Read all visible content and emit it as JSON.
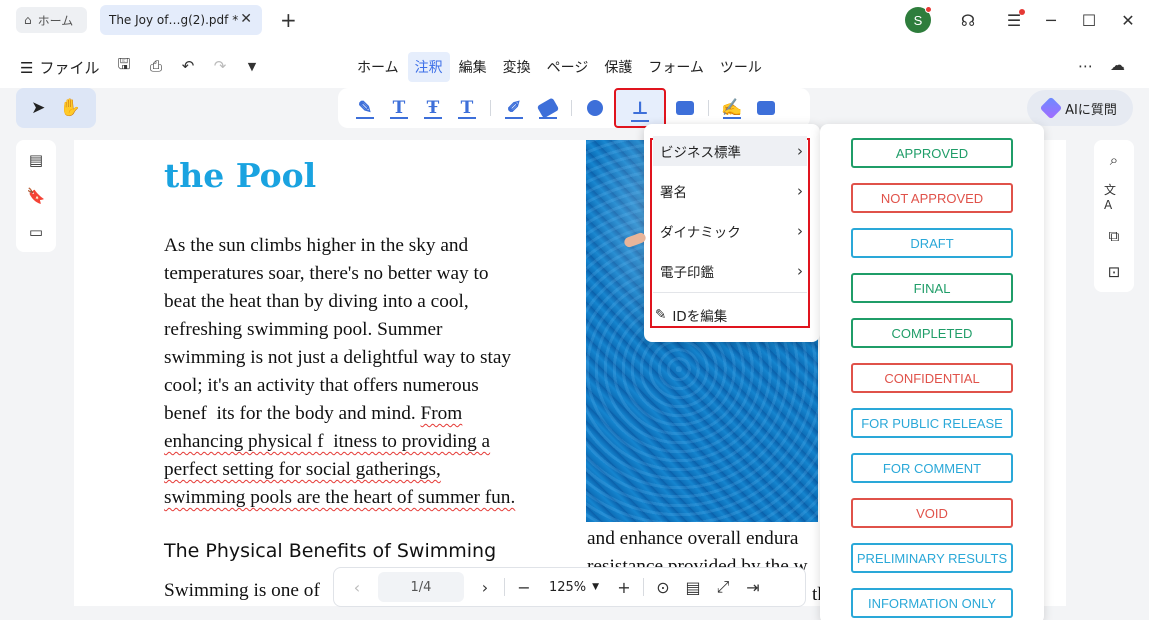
{
  "titlebar": {
    "home_label": "ホーム",
    "doc_tab_label": "The Joy of…g(2).pdf *",
    "avatar_letter": "S"
  },
  "menu": {
    "file_label": "ファイル",
    "tabs": [
      "ホーム",
      "注釈",
      "編集",
      "変換",
      "ページ",
      "保護",
      "フォーム",
      "ツール"
    ],
    "active_tab": "注釈"
  },
  "toolbar": {
    "ai_label": "AIに質問"
  },
  "document": {
    "title": "the Pool",
    "paragraph": [
      "As the sun climbs higher in the sky and",
      "temperatures soar, there's no better way to",
      "beat the heat than by diving into a cool,",
      "refreshing swimming pool. Summer",
      "swimming is not just a delightful way to stay",
      "cool; it's an activity that offers numerous",
      "benef  its for the body and mind.",
      "From",
      "enhancing physical f  itness to providing a",
      "perfect setting for social gatherings,",
      "swimming pools are the heart of summer fun."
    ],
    "heading2": "The Physical Benefits of Swimming",
    "last_line": "Swimming is one of",
    "right_col_line1": "and enhance overall endura",
    "right_col_line2": "resistance provided by the w",
    "right_col_line3": "th"
  },
  "bottom_nav": {
    "page": "1/4",
    "zoom": "125%"
  },
  "stamp_menu": {
    "items": [
      "ビジネス標準",
      "署名",
      "ダイナミック",
      "電子印鑑"
    ],
    "edit_id": "IDを編集"
  },
  "stamps": [
    {
      "label": "APPROVED",
      "color": "#1f9d68"
    },
    {
      "label": "NOT APPROVED",
      "color": "#e0524a"
    },
    {
      "label": "DRAFT",
      "color": "#2aa8d8"
    },
    {
      "label": "FINAL",
      "color": "#1f9d68"
    },
    {
      "label": "COMPLETED",
      "color": "#1f9d68"
    },
    {
      "label": "CONFIDENTIAL",
      "color": "#e0524a"
    },
    {
      "label": "FOR PUBLIC RELEASE",
      "color": "#2aa8d8"
    },
    {
      "label": "FOR COMMENT",
      "color": "#2aa8d8"
    },
    {
      "label": "VOID",
      "color": "#e0524a"
    },
    {
      "label": "PRELIMINARY RESULTS",
      "color": "#2aa8d8"
    },
    {
      "label": "INFORMATION ONLY",
      "color": "#2aa8d8"
    }
  ],
  "icons": [
    "home-icon",
    "close-icon",
    "plus-icon",
    "headset-icon",
    "minimize-icon",
    "maximize-icon",
    "menu-icon",
    "save-icon",
    "print-icon",
    "undo-icon",
    "redo-icon",
    "share-icon",
    "cloud-icon",
    "select-icon",
    "hand-icon",
    "stamp-icon",
    "search-icon",
    "translate-icon"
  ]
}
